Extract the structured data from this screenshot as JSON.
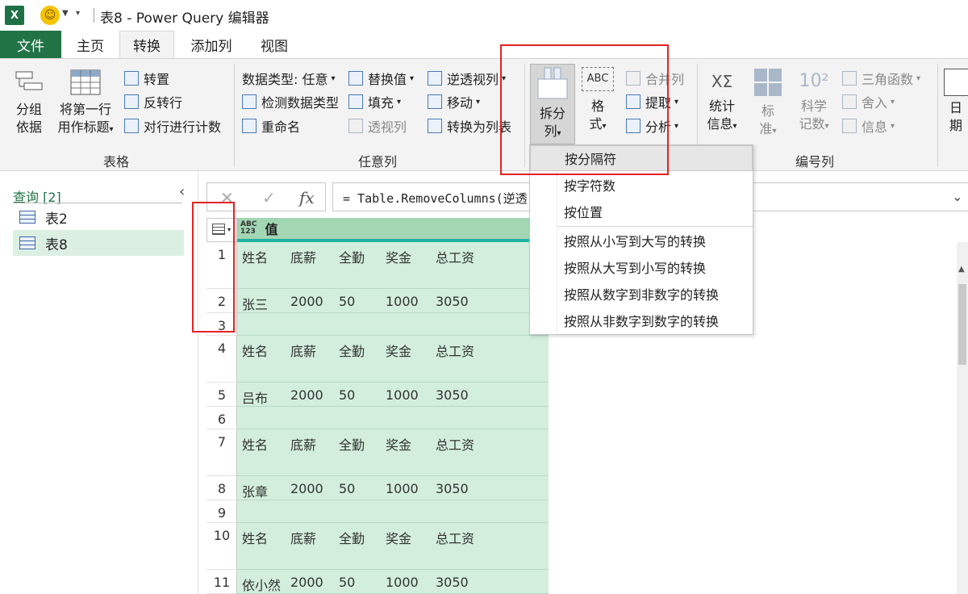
{
  "window": {
    "title": "表8 - Power Query 编辑器",
    "app_icon_letter": "X",
    "qat_dropdown": "▾"
  },
  "tabs": {
    "file": "文件",
    "items": [
      "主页",
      "转换",
      "添加列",
      "视图"
    ],
    "active": "转换"
  },
  "ribbon": {
    "table_group": {
      "label": "表格",
      "group_by": "分组依据",
      "group_by_l1": "分组",
      "group_by_l2": "依据",
      "first_row_l1": "将第一行",
      "first_row_l2": "用作标题",
      "transpose": "转置",
      "reverse_rows": "反转行",
      "count_rows": "对行进行计数"
    },
    "any_column_group": {
      "label": "任意列",
      "data_type": "数据类型: 任意",
      "detect_type": "检测数据类型",
      "rename": "重命名",
      "replace_values": "替换值",
      "fill": "填充",
      "pivot": "透视列",
      "unpivot": "逆透视列",
      "move": "移动",
      "convert_to_list": "转换为列表"
    },
    "text_column_group": {
      "split_l1": "拆分",
      "split_l2": "列",
      "format_l1": "格",
      "format_l2": "式",
      "merge_columns": "合并列",
      "extract": "提取",
      "parse": "分析",
      "format_icon_text": "ABC"
    },
    "number_column_group": {
      "label": "编号列",
      "statistics_l1": "统计",
      "statistics_l2": "信息",
      "standard_l1": "标",
      "standard_l2": "准",
      "scientific_l1": "科学",
      "scientific_l2": "记数",
      "trig": "三角函数",
      "rounding": "舍入",
      "information": "信息",
      "sci_icon": "10²",
      "stat_icon": "XΣ"
    },
    "date_group": {
      "date_l1": "日",
      "date_l2": "期"
    }
  },
  "queries": {
    "title": "查询 [2]",
    "items": [
      {
        "label": "表2",
        "selected": false
      },
      {
        "label": "表8",
        "selected": true
      }
    ]
  },
  "formula": {
    "text": "= Table.RemoveColumns(逆透",
    "fx": "fx"
  },
  "grid": {
    "column_name": "值",
    "type_icon_top": "ABC",
    "type_icon_bottom": "123",
    "rows": [
      {
        "num": "1",
        "cells": [
          "姓名",
          "底薪",
          "全勤",
          "奖金",
          "总工资"
        ]
      },
      {
        "num": "2",
        "cells": [
          "张三",
          "2000",
          "50",
          "1000",
          "3050"
        ]
      },
      {
        "num": "3",
        "cells": []
      },
      {
        "num": "4",
        "cells": [
          "姓名",
          "底薪",
          "全勤",
          "奖金",
          "总工资"
        ]
      },
      {
        "num": "5",
        "cells": [
          "吕布",
          "2000",
          "50",
          "1000",
          "3050"
        ]
      },
      {
        "num": "6",
        "cells": []
      },
      {
        "num": "7",
        "cells": [
          "姓名",
          "底薪",
          "全勤",
          "奖金",
          "总工资"
        ]
      },
      {
        "num": "8",
        "cells": [
          "张章",
          "2000",
          "50",
          "1000",
          "3050"
        ]
      },
      {
        "num": "9",
        "cells": []
      },
      {
        "num": "10",
        "cells": [
          "姓名",
          "底薪",
          "全勤",
          "奖金",
          "总工资"
        ]
      },
      {
        "num": "11",
        "cells": [
          "依小然",
          "2000",
          "50",
          "1000",
          "3050"
        ]
      }
    ]
  },
  "split_menu": {
    "items": [
      "按分隔符",
      "按字符数",
      "按位置",
      "按照从小写到大写的转换",
      "按照从大写到小写的转换",
      "按照从数字到非数字的转换",
      "按照从非数字到数字的转换"
    ],
    "hovered": "按分隔符"
  },
  "colors": {
    "excel_green": "#217346",
    "highlight_red": "#e32222",
    "row_green": "#d3eedd",
    "header_green": "#a3d6b3"
  }
}
